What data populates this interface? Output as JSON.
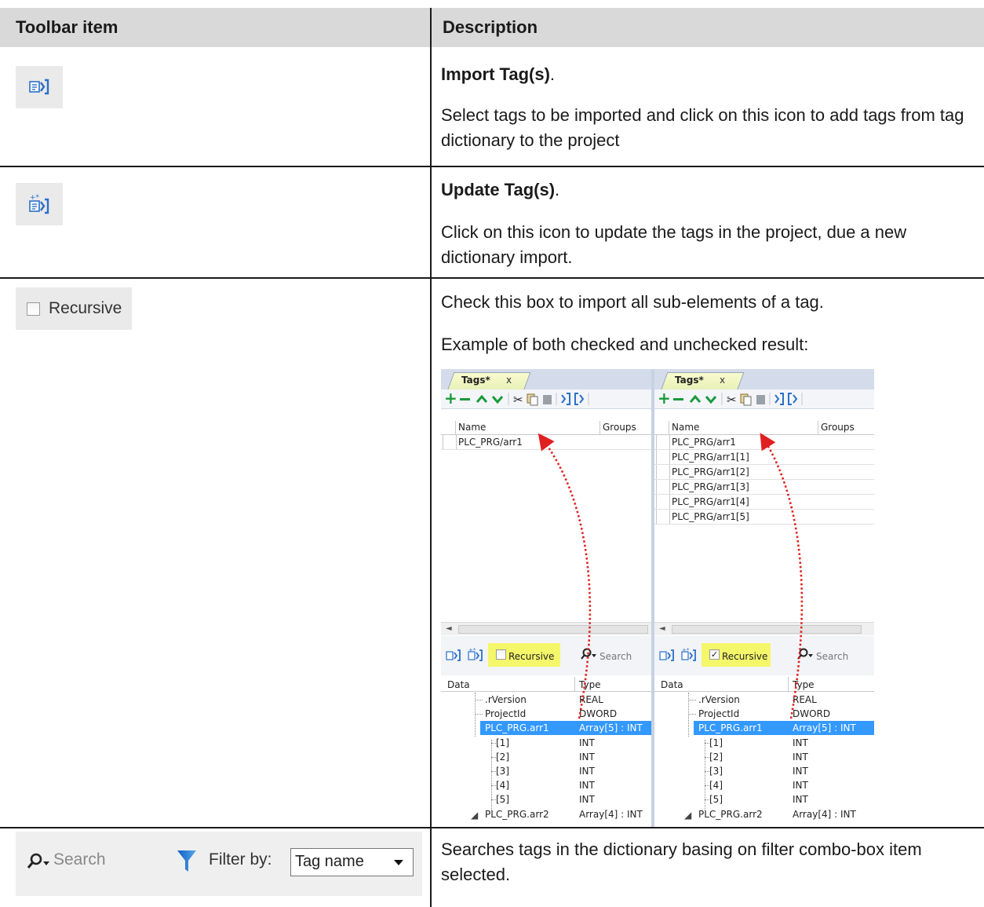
{
  "table": {
    "col_toolbar_item": "Toolbar item",
    "col_description": "Description"
  },
  "rows": {
    "import": {
      "title": "Import Tag(s)",
      "title_suffix": ".",
      "text": "Select tags to be imported and click on this icon to add tags from tag dictionary to the project"
    },
    "update": {
      "title": "Update Tag(s)",
      "title_suffix": ".",
      "text": "Click on this icon to update the tags in the project, due a new dictionary import."
    },
    "recursive": {
      "checkbox_label": "Recursive",
      "text": "Check this box to import all sub-elements of a tag.",
      "example_caption": "Example of both checked and unchecked result:"
    },
    "search": {
      "search_placeholder": "Search",
      "filter_label": "Filter by:",
      "filter_value": "Tag name",
      "text": "Searches tags in the dictionary basing on filter combo-box item selected."
    }
  },
  "example": {
    "tab_title": "Tags*",
    "tab_close": "x",
    "grid_col_name": "Name",
    "grid_col_groups": "Groups",
    "left_tags": [
      "PLC_PRG/arr1"
    ],
    "right_tags": [
      "PLC_PRG/arr1",
      "PLC_PRG/arr1[1]",
      "PLC_PRG/arr1[2]",
      "PLC_PRG/arr1[3]",
      "PLC_PRG/arr1[4]",
      "PLC_PRG/arr1[5]"
    ],
    "recursive_label": "Recursive",
    "left_recursive_checked": false,
    "right_recursive_checked": true,
    "search_placeholder": "Search",
    "data_col": "Data",
    "type_col": "Type",
    "dict_rows": [
      {
        "name": ".rVersion",
        "type": "REAL",
        "level": 1,
        "selected": false
      },
      {
        "name": "ProjectId",
        "type": "DWORD",
        "level": 1,
        "selected": false
      },
      {
        "name": "PLC_PRG.arr1",
        "type": "Array[5] : INT",
        "level": 1,
        "selected": true,
        "expanded": true
      },
      {
        "name": "[1]",
        "type": "INT",
        "level": 2,
        "selected": false
      },
      {
        "name": "[2]",
        "type": "INT",
        "level": 2,
        "selected": false
      },
      {
        "name": "[3]",
        "type": "INT",
        "level": 2,
        "selected": false
      },
      {
        "name": "[4]",
        "type": "INT",
        "level": 2,
        "selected": false
      },
      {
        "name": "[5]",
        "type": "INT",
        "level": 2,
        "selected": false
      },
      {
        "name": "PLC_PRG.arr2",
        "type": "Array[4] : INT",
        "level": 1,
        "selected": false,
        "expanded": true
      }
    ],
    "colors": {
      "accent_select": "#3399ff",
      "highlight": "#f5f76a",
      "arrow": "#e02020",
      "toolbar_green": "#1a9a3a"
    }
  },
  "icons": [
    "import-tags-icon",
    "update-tags-icon",
    "search-icon",
    "funnel-icon",
    "dropdown-arrow-icon",
    "checkbox-icon"
  ]
}
